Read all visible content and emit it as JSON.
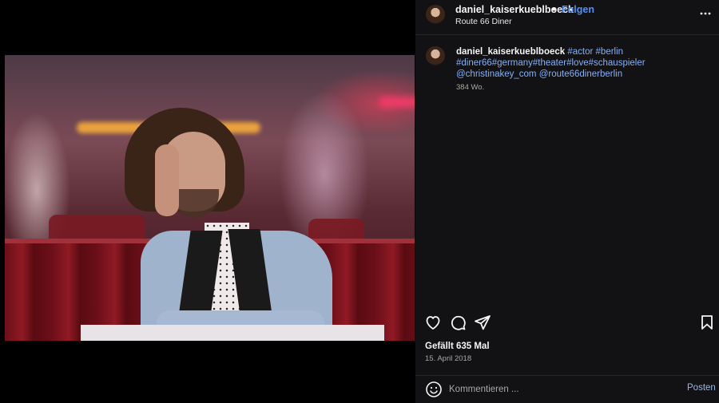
{
  "post": {
    "username": "daniel_kaiserkueblboeck",
    "follow_label": "Folgen",
    "separator": "•",
    "location": "Route 66 Diner",
    "more_label": "•••"
  },
  "caption": {
    "username": "daniel_kaiserkueblboeck",
    "parts": [
      "#actor",
      " ",
      "#berlin",
      " ",
      "#diner66",
      "#germany",
      "#theater",
      "#love",
      "#schauspieler",
      " ",
      "@christinakey_com",
      " ",
      "@route66dinerberlin"
    ],
    "time_ago": "384 Wo."
  },
  "engagement": {
    "likes": "Gefällt 635 Mal",
    "date": "15. April 2018"
  },
  "comment": {
    "placeholder": "Kommentieren ...",
    "post_label": "Posten"
  },
  "icons": [
    "heart-icon",
    "comment-icon",
    "share-icon",
    "bookmark-icon",
    "emoji-icon",
    "more-icon"
  ],
  "colors": {
    "accent": "#4f8ff7",
    "hashtag": "#86b0f5",
    "panel_bg": "#121214",
    "muted_text": "#a8a8a8"
  }
}
